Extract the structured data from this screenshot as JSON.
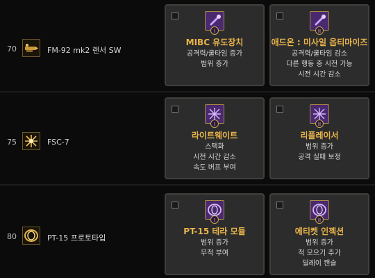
{
  "rows": [
    {
      "level": "70",
      "skill_name": "FM-92 mk2 랜서 SW",
      "icon": "missile-launcher-icon",
      "options": [
        {
          "title": "MIBC 유도장치",
          "badge": "I",
          "lines": [
            "공격력/쿨타임 증가",
            "범위 증가"
          ]
        },
        {
          "title": "애드온 : 미사일 옵티마이즈",
          "badge": "II",
          "lines": [
            "공격력/쿨타임 감소",
            "다른 행동 중 시전 가능",
            "시전 시간 감소"
          ]
        }
      ]
    },
    {
      "level": "75",
      "skill_name": "FSC-7",
      "icon": "starburst-icon",
      "options": [
        {
          "title": "라이트웨이트",
          "badge": "I",
          "lines": [
            "스택화",
            "시전 시간 감소",
            "속도 버프 부여"
          ]
        },
        {
          "title": "리플레이서",
          "badge": "II",
          "lines": [
            "범위 증가",
            "공격 실패 보정"
          ]
        }
      ]
    },
    {
      "level": "80",
      "skill_name": "PT-15 프로토타입",
      "icon": "coil-ring-icon",
      "options": [
        {
          "title": "PT-15 테라 모듈",
          "badge": "I",
          "lines": [
            "범위 증가",
            "무적 부여"
          ]
        },
        {
          "title": "에티켓 인젝션",
          "badge": "II",
          "lines": [
            "범위 증가",
            "적 모으기 추가",
            "딜레이 캔슬"
          ]
        }
      ]
    }
  ]
}
